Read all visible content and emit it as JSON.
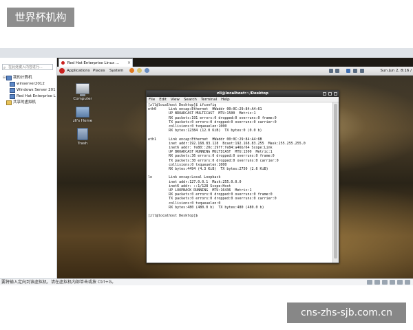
{
  "watermarks": {
    "logo_text": "世界杯机构",
    "site_text": "cns-zhs-sjb.com.cn"
  },
  "library": {
    "search_placeholder": "在此处键入内容进行...",
    "tree": {
      "my_computer": "我的计算机",
      "vms": [
        "winserver2012",
        "Windows Server 201",
        "Red Hat Enterprise L"
      ],
      "shared": "共享的虚拟机"
    }
  },
  "vm_tab": {
    "label": "Red Hat Enterprise Linux ..."
  },
  "gnome_panel": {
    "menus": [
      "Applications",
      "Places",
      "System"
    ],
    "clock": "Sun Jun 2,  8:16 /"
  },
  "desktop_icons": [
    "Computer",
    "zll's Home",
    "Trash"
  ],
  "terminal": {
    "title": "zll@localhost:~/Desktop",
    "menus": [
      "File",
      "Edit",
      "View",
      "Search",
      "Terminal",
      "Help"
    ],
    "output": "[zll@localhost Desktop]$ ifconfig\neth0      Link encap:Ethernet  HWaddr 00:0C:29:84:A4:61\n          UP BROADCAST MULTICAST  MTU:1500  Metric:1\n          RX packets:191 errors:0 dropped:0 overruns:0 frame:0\n          TX packets:0 errors:0 dropped:0 overruns:0 carrier:0\n          collisions:0 txqueuelen:1000\n          RX bytes:12384 (12.0 KiB)  TX bytes:0 (0.0 b)\n\neth1      Link encap:Ethernet  HWaddr 00:0C:29:84:A4:6B\n          inet addr:192.168.83.128  Bcast:192.168.83.255  Mask:255.255.255.0\n          inet6 addr: fe80::20c:29ff:fe84:a46b/64 Scope:Link\n          UP BROADCAST RUNNING MULTICAST  MTU:1500  Metric:1\n          RX packets:36 errors:0 dropped:0 overruns:0 frame:0\n          TX packets:30 errors:0 dropped:0 overruns:0 carrier:0\n          collisions:0 txqueuelen:1000\n          RX bytes:4494 (4.3 KiB)  TX bytes:2750 (2.6 KiB)\n\nlo        Link encap:Local Loopback\n          inet addr:127.0.0.1  Mask:255.0.0.0\n          inet6 addr: ::1/128 Scope:Host\n          UP LOOPBACK RUNNING  MTU:16436  Metric:1\n          RX packets:0 errors:0 dropped:0 overruns:0 frame:0\n          TX packets:0 errors:0 dropped:0 overruns:0 carrier:0\n          collisions:0 txqueuelen:0\n          RX bytes:480 (480.0 b)  TX bytes:480 (480.0 b)\n\n[zll@localhost Desktop]$ "
  },
  "status_bar": {
    "text": "要将输入定向到该虚拟机，请在虚拟机内部单击或按 Ctrl+G。"
  },
  "colors": {
    "redhat_red": "#c9211e",
    "panel_gray": "#d7d7d7",
    "terminal_bg": "#ffffff"
  }
}
